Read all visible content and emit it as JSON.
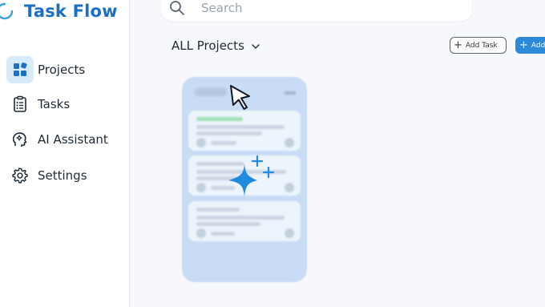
{
  "app": {
    "title": "Task Flow"
  },
  "sidebar": {
    "items": [
      {
        "label": "Projects",
        "icon": "projects-icon",
        "active": true
      },
      {
        "label": "Tasks",
        "icon": "clipboard-icon",
        "active": false
      },
      {
        "label": "AI Assistant",
        "icon": "ai-head-icon",
        "active": false
      },
      {
        "label": "Settings",
        "icon": "gear-icon",
        "active": false
      }
    ]
  },
  "search": {
    "placeholder": "Search"
  },
  "main": {
    "projects_selector": "ALL Projects",
    "add_task_label": "Add Task",
    "add_filled_label": "Add"
  },
  "colors": {
    "brand": "#1b6fc4",
    "accent": "#2b8ad8",
    "active_bg": "#d8ebfb",
    "card_bg": "#c9dcf5"
  }
}
